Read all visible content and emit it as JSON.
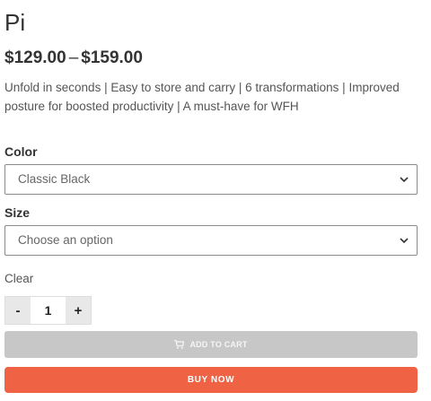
{
  "product": {
    "title": "Pi",
    "price_low": "$129.00",
    "price_sep": "–",
    "price_high": "$159.00",
    "description": "Unfold in seconds | Easy to store and carry | 6 transformations | Improved posture for boosted productivity | A must-have for WFH"
  },
  "variations": {
    "color_label": "Color",
    "color_value": "Classic Black",
    "size_label": "Size",
    "size_value": "Choose an option",
    "clear_label": "Clear"
  },
  "quantity": {
    "minus": "-",
    "value": "1",
    "plus": "+"
  },
  "actions": {
    "add_to_cart_label": "ADD TO CART",
    "buy_now_label": "BUY NOW",
    "cart_icon": "cart-icon"
  },
  "colors": {
    "add_to_cart_bg": "#c7c7c7",
    "buy_now_bg": "#ef6243"
  }
}
